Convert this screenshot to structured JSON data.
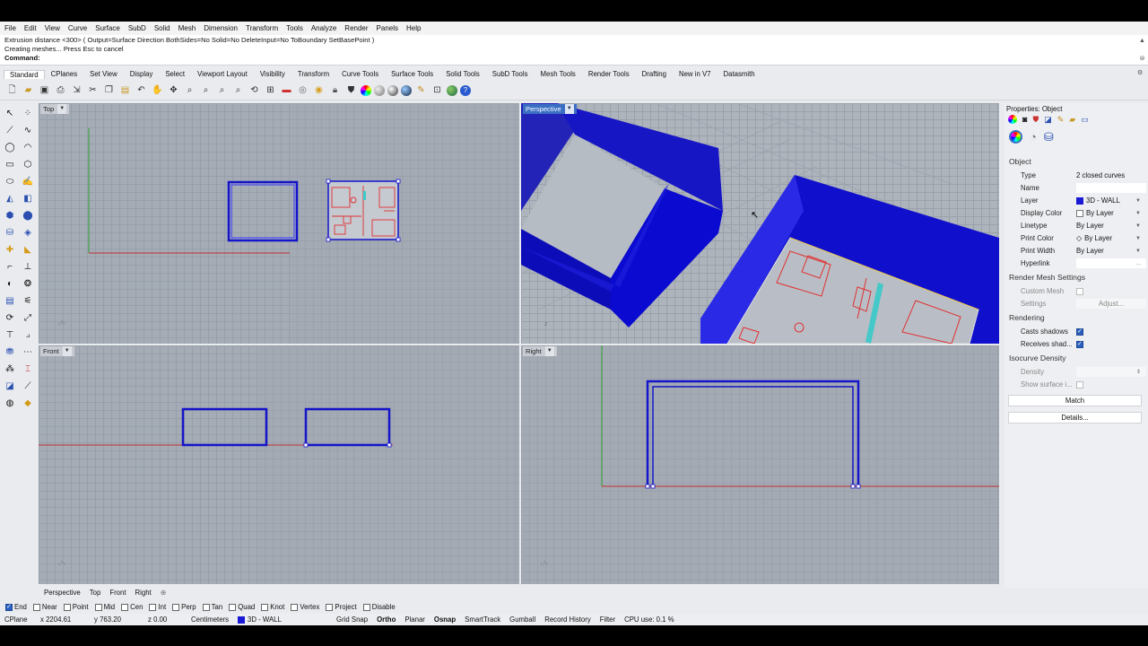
{
  "menu": [
    "File",
    "Edit",
    "View",
    "Curve",
    "Surface",
    "SubD",
    "Solid",
    "Mesh",
    "Dimension",
    "Transform",
    "Tools",
    "Analyze",
    "Render",
    "Panels",
    "Help"
  ],
  "command": {
    "history_line1": "Extrusion distance <300> ( Output=Surface  Direction  BothSides=No  Solid=No  DeleteInput=No  ToBoundary  SetBasePoint )",
    "history_line2": "Creating meshes... Press Esc to cancel",
    "prompt": "Command:"
  },
  "tabs": [
    "Standard",
    "CPlanes",
    "Set View",
    "Display",
    "Select",
    "Viewport Layout",
    "Visibility",
    "Transform",
    "Curve Tools",
    "Surface Tools",
    "Solid Tools",
    "SubD Tools",
    "Mesh Tools",
    "Render Tools",
    "Drafting",
    "New in V7",
    "Datasmith"
  ],
  "toolbar_icons": [
    "new-icon",
    "open-icon",
    "save-icon",
    "print-icon",
    "import-icon",
    "cut-icon",
    "copy-icon",
    "paste-icon",
    "undo-icon",
    "pan-icon",
    "rotate-view-icon",
    "zoom-icon",
    "zoom-window-icon",
    "zoom-extents-icon",
    "zoom-selected-icon",
    "undo-view-icon",
    "four-viewports-icon",
    "car-icon",
    "select-icon",
    "light-icon",
    "lock-icon",
    "shield-icon",
    "color-wheel-icon",
    "sphere-icon",
    "shaded-sphere-icon",
    "render-sphere-icon",
    "paint-icon",
    "grid-icon",
    "globe-icon",
    "help-icon"
  ],
  "left_tools": [
    "select-arrow-icon",
    "point-icon",
    "polyline-icon",
    "curve-icon",
    "circle-icon",
    "arc-icon",
    "rectangle-icon",
    "polygon-icon",
    "ellipse-icon",
    "freeform-icon",
    "surface-icon",
    "extrude-icon",
    "box-icon",
    "sphere-tool-icon",
    "cylinder-icon",
    "mesh-icon",
    "boolean-icon",
    "fillet-icon",
    "split-icon",
    "trim-icon",
    "join-icon",
    "explode-icon",
    "move-icon",
    "copy-tool-icon",
    "rotate-tool-icon",
    "scale-icon",
    "array-icon",
    "mirror-icon",
    "dimension-icon",
    "text-icon",
    "analyze-icon",
    "curvature-icon",
    "block-icon",
    "layer-tool-icon",
    "render-tool-icon",
    "material-icon"
  ],
  "viewports": {
    "top": "Top",
    "perspective": "Perspective",
    "front": "Front",
    "right": "Right"
  },
  "viewport_tabs": [
    "Perspective",
    "Top",
    "Front",
    "Right"
  ],
  "viewport_tab_add": "⊕",
  "osnaps": [
    {
      "label": "End",
      "on": true
    },
    {
      "label": "Near",
      "on": false
    },
    {
      "label": "Point",
      "on": false
    },
    {
      "label": "Mid",
      "on": false
    },
    {
      "label": "Cen",
      "on": false
    },
    {
      "label": "Int",
      "on": false
    },
    {
      "label": "Perp",
      "on": false
    },
    {
      "label": "Tan",
      "on": false
    },
    {
      "label": "Quad",
      "on": false
    },
    {
      "label": "Knot",
      "on": false
    },
    {
      "label": "Vertex",
      "on": false
    },
    {
      "label": "Project",
      "on": false
    },
    {
      "label": "Disable",
      "on": false
    }
  ],
  "status": {
    "cplane": "CPlane",
    "x": "x 2204.61",
    "y": "y 763.20",
    "z": "z 0.00",
    "units": "Centimeters",
    "layer": "3D - WALL",
    "layer_color": "#1a1ad6",
    "grid_snap": "Grid Snap",
    "ortho": "Ortho",
    "planar": "Planar",
    "osnap": "Osnap",
    "smarttrack": "SmartTrack",
    "gumball": "Gumball",
    "record_history": "Record History",
    "filter": "Filter",
    "cpu": "CPU use: 0.1 %"
  },
  "properties": {
    "title": "Properties: Object",
    "section_object": "Object",
    "rows": [
      {
        "key": "Type",
        "value": "2 closed curves"
      },
      {
        "key": "Name",
        "value": ""
      },
      {
        "key": "Layer",
        "value": "3D - WALL"
      },
      {
        "key": "Display Color",
        "value": "By Layer"
      },
      {
        "key": "Linetype",
        "value": "By Layer"
      },
      {
        "key": "Print Color",
        "value": "By Layer"
      },
      {
        "key": "Print Width",
        "value": "By Layer"
      },
      {
        "key": "Hyperlink",
        "value": ""
      }
    ],
    "hyperlink_button": "...",
    "section_mesh": "Render Mesh Settings",
    "custom_mesh": "Custom Mesh",
    "settings": "Settings",
    "adjust": "Adjust...",
    "section_rendering": "Rendering",
    "casts_shadows": "Casts shadows",
    "receives_shadows": "Receives shad...",
    "section_isocurve": "Isocurve Density",
    "density": "Density",
    "show_surface": "Show surface i...",
    "match_button": "Match",
    "details_button": "Details..."
  },
  "colors": {
    "wall_blue": "#1414c8",
    "accent_blue": "#3b6fc4",
    "plan_red": "#e03030"
  }
}
